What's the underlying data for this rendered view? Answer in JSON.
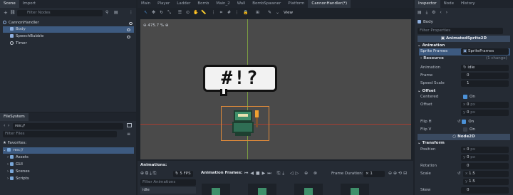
{
  "scene_dock": {
    "tabs": [
      "Scene",
      "Import"
    ],
    "filter_placeholder": "Filter Nodes",
    "nodes": [
      "CannonHandler",
      "Body",
      "SpeechBubble",
      "Timer"
    ]
  },
  "filesystem_dock": {
    "tab": "FileSystem",
    "path": "res://",
    "filter_placeholder": "Filter Files",
    "favorites_label": "Favorites:",
    "root_label": "res://",
    "folders": [
      "Assets",
      "GUI",
      "Scenes",
      "Scripts"
    ]
  },
  "editor_tabs": [
    "Main",
    "Player",
    "Ladder",
    "Bomb",
    "Main_2",
    "Wall",
    "BombSpawner",
    "Platform",
    "CannonHandler(*)"
  ],
  "toolbar": {
    "view_label": "View",
    "zoom_label": "475.7 %"
  },
  "canvas": {
    "bubble_text": "#!?"
  },
  "animation_panel": {
    "animations_label": "Animations:",
    "fps_label": "5 FPS",
    "frames_label": "Animation Frames:",
    "frame_duration_label": "Frame Duration:",
    "frame_duration_value": "1",
    "filter_placeholder": "Filter Animations",
    "selected_animation": "idle"
  },
  "inspector": {
    "tabs": [
      "Inspector",
      "Node",
      "History"
    ],
    "node_name": "Body",
    "filter_placeholder": "Filter Properties",
    "class_name": "AnimatedSprite2D",
    "sections": {
      "animation": "Animation",
      "offset": "Offset",
      "node2d": "Node2D",
      "transform": "Transform"
    },
    "sprite_frames_label": "Sprite Frames",
    "sprite_frames_value": "SpriteFrames",
    "resource_label": "Resource",
    "resource_changes": "(1 change)",
    "animation_label": "Animation",
    "animation_value": "idle",
    "frame_label": "Frame",
    "frame_value": "0",
    "speed_label": "Speed Scale",
    "speed_value": "1",
    "centered_label": "Centered",
    "centered_value": "On",
    "offset_label": "Offset",
    "offset_x": "0",
    "offset_y": "0",
    "flip_h_label": "Flip H",
    "flip_h_value": "On",
    "flip_v_label": "Flip V",
    "flip_v_value": "On",
    "position_label": "Position",
    "position_x": "0",
    "position_y": "0",
    "rotation_label": "Rotation",
    "rotation_value": "0",
    "scale_label": "Scale",
    "scale_x": "1.5",
    "scale_y": "1.5",
    "skew_label": "Skew",
    "skew_value": "0",
    "unit_px": "px",
    "axis_x": "x",
    "axis_y": "y"
  },
  "colors": {
    "accent": "#4c92d8",
    "selection": "#3d5a80",
    "viewport": "#4a4a4a",
    "guide_red": "#c0392b",
    "guide_green": "#8fbf3f",
    "selection_box": "#e08a3a"
  }
}
